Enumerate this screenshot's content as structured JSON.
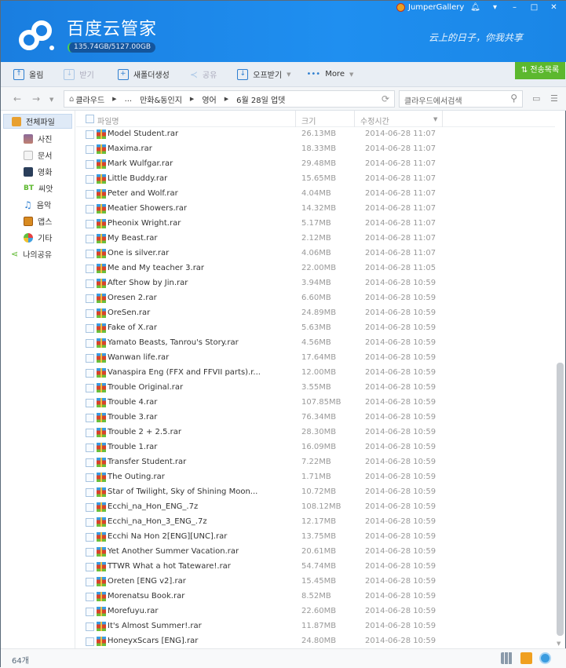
{
  "header": {
    "app_title": "百度云管家",
    "quota": "135.74GB/5127.00GB",
    "username": "JumperGallery",
    "slogan": "云上的日子，你我共享",
    "window_buttons": [
      "bell",
      "menu",
      "minimize",
      "maximize",
      "close"
    ]
  },
  "toolbar": {
    "upload": "올림",
    "download": "받기",
    "new_folder": "새폴더생성",
    "share": "공유",
    "offline": "오프받기",
    "more": "More",
    "transfer_list": "전송목록"
  },
  "address": {
    "crumbs": [
      "클라우드",
      "...",
      "만화&동인지",
      "영어",
      "6월 28일 업뎃"
    ],
    "search_placeholder": "클라우드에서검색"
  },
  "sidebar": {
    "items": [
      {
        "label": "전체파일",
        "icon": "folder-icon"
      },
      {
        "label": "사진",
        "icon": "photo-icon"
      },
      {
        "label": "문서",
        "icon": "document-icon"
      },
      {
        "label": "영화",
        "icon": "film-icon"
      },
      {
        "label": "씨앗",
        "icon": "bt-icon"
      },
      {
        "label": "음악",
        "icon": "music-icon"
      },
      {
        "label": "앱스",
        "icon": "apps-icon"
      },
      {
        "label": "기타",
        "icon": "other-icon"
      },
      {
        "label": "나의공유",
        "icon": "share-icon"
      }
    ]
  },
  "columns": {
    "name": "파일명",
    "size": "크기",
    "modified": "수정시간"
  },
  "files": [
    {
      "name": "Model Student.rar",
      "size": "26.13MB",
      "date": "2014-06-28 11:07"
    },
    {
      "name": "Maxima.rar",
      "size": "18.33MB",
      "date": "2014-06-28 11:07"
    },
    {
      "name": "Mark Wulfgar.rar",
      "size": "29.48MB",
      "date": "2014-06-28 11:07"
    },
    {
      "name": "Little Buddy.rar",
      "size": "15.65MB",
      "date": "2014-06-28 11:07"
    },
    {
      "name": "Peter and Wolf.rar",
      "size": "4.04MB",
      "date": "2014-06-28 11:07"
    },
    {
      "name": "Meatier Showers.rar",
      "size": "14.32MB",
      "date": "2014-06-28 11:07"
    },
    {
      "name": "Pheonix Wright.rar",
      "size": "5.17MB",
      "date": "2014-06-28 11:07"
    },
    {
      "name": "My Beast.rar",
      "size": "2.12MB",
      "date": "2014-06-28 11:07"
    },
    {
      "name": "One is silver.rar",
      "size": "4.06MB",
      "date": "2014-06-28 11:07"
    },
    {
      "name": "Me and My teacher 3.rar",
      "size": "22.00MB",
      "date": "2014-06-28 11:05"
    },
    {
      "name": "After Show by Jin.rar",
      "size": "3.94MB",
      "date": "2014-06-28 10:59"
    },
    {
      "name": "Oresen 2.rar",
      "size": "6.60MB",
      "date": "2014-06-28 10:59"
    },
    {
      "name": "OreSen.rar",
      "size": "24.89MB",
      "date": "2014-06-28 10:59"
    },
    {
      "name": "Fake of X.rar",
      "size": "5.63MB",
      "date": "2014-06-28 10:59"
    },
    {
      "name": "Yamato Beasts, Tanrou's Story.rar",
      "size": "4.56MB",
      "date": "2014-06-28 10:59"
    },
    {
      "name": "Wanwan life.rar",
      "size": "17.64MB",
      "date": "2014-06-28 10:59"
    },
    {
      "name": "Vanaspira Eng (FFX and FFVII parts).r...",
      "size": "12.00MB",
      "date": "2014-06-28 10:59"
    },
    {
      "name": "Trouble Original.rar",
      "size": "3.55MB",
      "date": "2014-06-28 10:59"
    },
    {
      "name": "Trouble 4.rar",
      "size": "107.85MB",
      "date": "2014-06-28 10:59"
    },
    {
      "name": "Trouble 3.rar",
      "size": "76.34MB",
      "date": "2014-06-28 10:59"
    },
    {
      "name": "Trouble 2 + 2.5.rar",
      "size": "28.30MB",
      "date": "2014-06-28 10:59"
    },
    {
      "name": "Trouble 1.rar",
      "size": "16.09MB",
      "date": "2014-06-28 10:59"
    },
    {
      "name": "Transfer Student.rar",
      "size": "7.22MB",
      "date": "2014-06-28 10:59"
    },
    {
      "name": "The Outing.rar",
      "size": "1.71MB",
      "date": "2014-06-28 10:59"
    },
    {
      "name": "Star of Twilight, Sky of Shining Moon...",
      "size": "10.72MB",
      "date": "2014-06-28 10:59"
    },
    {
      "name": "Ecchi_na_Hon_ENG_.7z",
      "size": "108.12MB",
      "date": "2014-06-28 10:59"
    },
    {
      "name": "Ecchi_na_Hon_3_ENG_.7z",
      "size": "12.17MB",
      "date": "2014-06-28 10:59"
    },
    {
      "name": "Ecchi Na Hon 2[ENG][UNC].rar",
      "size": "13.75MB",
      "date": "2014-06-28 10:59"
    },
    {
      "name": "Yet Another Summer Vacation.rar",
      "size": "20.61MB",
      "date": "2014-06-28 10:59"
    },
    {
      "name": "TTWR What a hot Tateware!.rar",
      "size": "54.74MB",
      "date": "2014-06-28 10:59"
    },
    {
      "name": "Oreten [ENG v2].rar",
      "size": "15.45MB",
      "date": "2014-06-28 10:59"
    },
    {
      "name": "Morenatsu Book.rar",
      "size": "8.52MB",
      "date": "2014-06-28 10:59"
    },
    {
      "name": "Morefuyu.rar",
      "size": "22.60MB",
      "date": "2014-06-28 10:59"
    },
    {
      "name": "It's Almost Summer!.rar",
      "size": "11.87MB",
      "date": "2014-06-28 10:59"
    },
    {
      "name": "HoneyxScars [ENG].rar",
      "size": "24.80MB",
      "date": "2014-06-28 10:59"
    }
  ],
  "status": {
    "count": "64개"
  }
}
